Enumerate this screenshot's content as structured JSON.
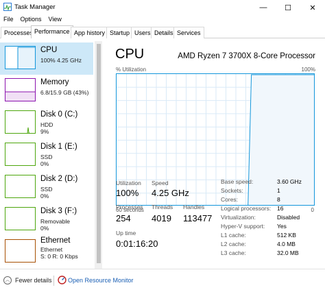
{
  "window": {
    "title": "Task Manager",
    "minimize": "—",
    "maximize": "☐",
    "close": "✕"
  },
  "menu": [
    "File",
    "Options",
    "View"
  ],
  "tabs": [
    "Processes",
    "Performance",
    "App history",
    "Startup",
    "Users",
    "Details",
    "Services"
  ],
  "active_tab": "Performance",
  "sidebar": {
    "items": [
      {
        "name": "CPU",
        "sub1": "100%  4.25 GHz",
        "sub2": "",
        "sub3": "",
        "color": "#1296db",
        "selected": true
      },
      {
        "name": "Memory",
        "sub1": "6.8/15.9 GB (43%)",
        "sub2": "",
        "sub3": "",
        "color": "#8b12ae",
        "selected": false
      },
      {
        "name": "Disk 0 (C:)",
        "sub1": "HDD",
        "sub2": "9%",
        "sub3": "",
        "color": "#4da60c",
        "selected": false
      },
      {
        "name": "Disk 1 (E:)",
        "sub1": "SSD",
        "sub2": "0%",
        "sub3": "",
        "color": "#4da60c",
        "selected": false
      },
      {
        "name": "Disk 2 (D:)",
        "sub1": "SSD",
        "sub2": "0%",
        "sub3": "",
        "color": "#4da60c",
        "selected": false
      },
      {
        "name": "Disk 3 (F:)",
        "sub1": "Removable",
        "sub2": "0%",
        "sub3": "",
        "color": "#4da60c",
        "selected": false
      },
      {
        "name": "Ethernet",
        "sub1": "Ethernet",
        "sub2": "S: 0  R: 0 Kbps",
        "sub3": "",
        "color": "#a74f01",
        "selected": false
      }
    ]
  },
  "cpu": {
    "title": "CPU",
    "model": "AMD Ryzen 7 3700X 8-Core Processor",
    "util_label": "% Utilization",
    "util_max": "100%",
    "time_left": "60 seconds",
    "time_right": "0",
    "utilization_label": "Utilization",
    "utilization": "100%",
    "speed_label": "Speed",
    "speed": "4.25 GHz",
    "processes_label": "Processes",
    "processes": "254",
    "threads_label": "Threads",
    "threads": "4019",
    "handles_label": "Handles",
    "handles": "113477",
    "uptime_label": "Up time",
    "uptime": "0:01:16:20",
    "specs": [
      {
        "label": "Base speed:",
        "value": "3.60 GHz"
      },
      {
        "label": "Sockets:",
        "value": "1"
      },
      {
        "label": "Cores:",
        "value": "8"
      },
      {
        "label": "Logical processors:",
        "value": "16"
      },
      {
        "label": "Virtualization:",
        "value": "Disabled"
      },
      {
        "label": "Hyper-V support:",
        "value": "Yes"
      },
      {
        "label": "L1 cache:",
        "value": "512 KB"
      },
      {
        "label": "L2 cache:",
        "value": "4.0 MB"
      },
      {
        "label": "L3 cache:",
        "value": "32.0 MB"
      }
    ],
    "graph_utilization_series": [
      0,
      0,
      0,
      0,
      0,
      0,
      0,
      0,
      0,
      0,
      0,
      0,
      0,
      0,
      0,
      0,
      0,
      0,
      0,
      0,
      0,
      0,
      0,
      0,
      0,
      0,
      0,
      0,
      0,
      0,
      0,
      0,
      0,
      0,
      0,
      0,
      0,
      0,
      0,
      0,
      100,
      100,
      100,
      100,
      100,
      100,
      100,
      100,
      100,
      100,
      100,
      100,
      100,
      100,
      100,
      100,
      100,
      100,
      100,
      100
    ]
  },
  "footer": {
    "fewer_details": "Fewer details",
    "open_monitor": "Open Resource Monitor"
  },
  "colors": {
    "cpu": "#1296db",
    "memory": "#8b12ae",
    "disk": "#4da60c",
    "ethernet": "#a74f01",
    "selected_bg": "#cde8f8"
  }
}
